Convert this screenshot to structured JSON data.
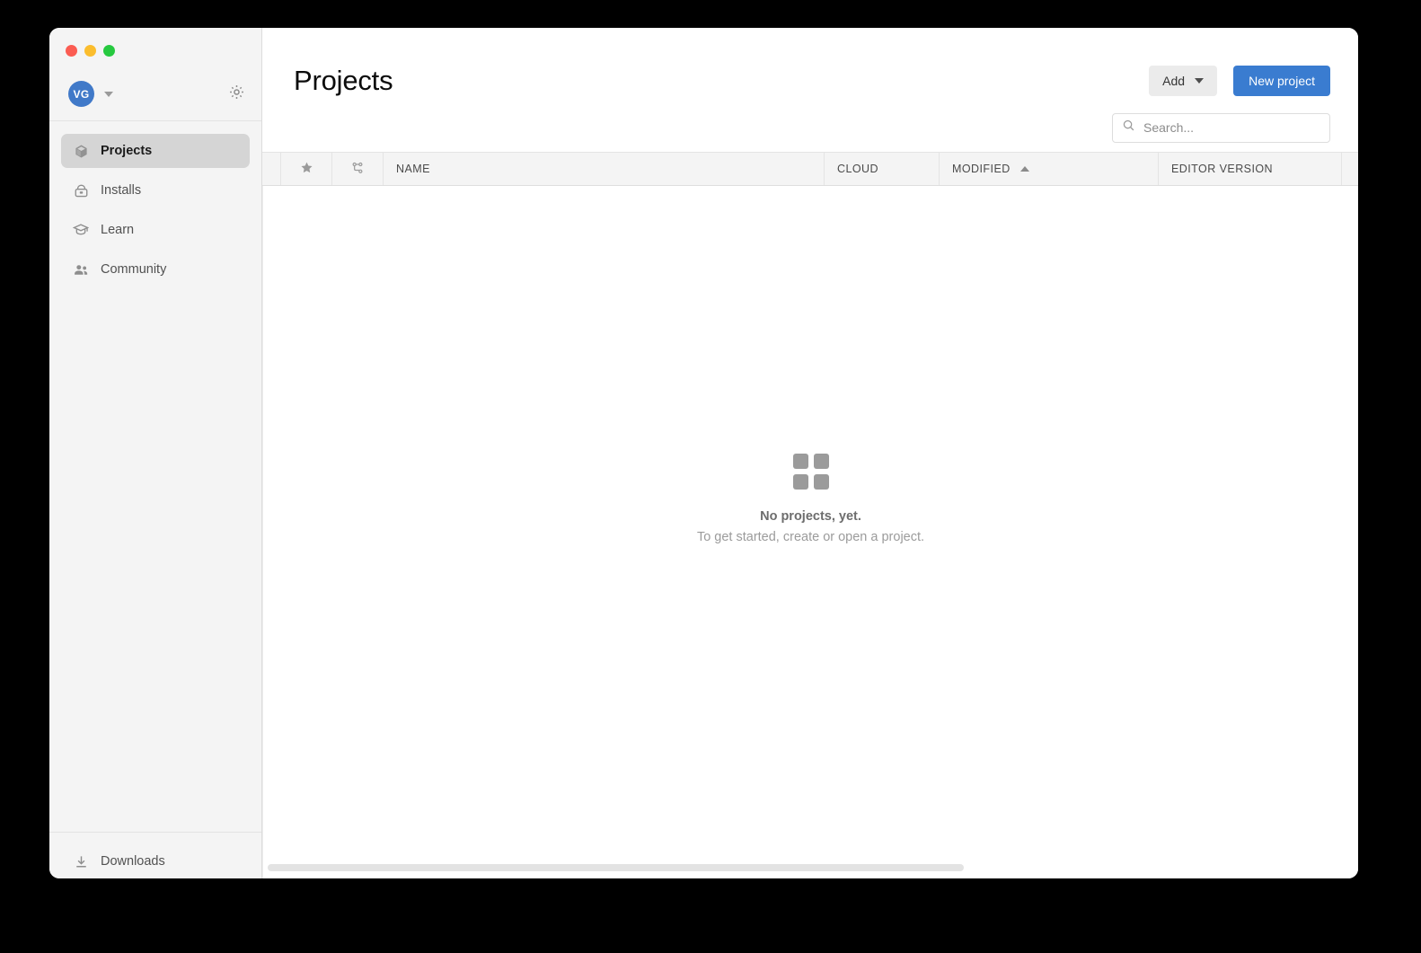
{
  "window": {
    "traffic_lights": [
      "close",
      "minimize",
      "maximize"
    ],
    "colors": {
      "accent": "#3a7cd0",
      "sidebar_bg": "#f4f4f4",
      "selected_item_bg": "#d5d5d5",
      "avatar_bg": "#4079c8"
    }
  },
  "sidebar": {
    "account": {
      "avatar_initials": "VG",
      "dropdown_icon": "chevron-down-icon",
      "settings_icon": "gear-icon"
    },
    "items": [
      {
        "label": "Projects",
        "icon": "cube-icon",
        "selected": true
      },
      {
        "label": "Installs",
        "icon": "install-icon",
        "selected": false
      },
      {
        "label": "Learn",
        "icon": "graduation-cap-icon",
        "selected": false
      },
      {
        "label": "Community",
        "icon": "people-icon",
        "selected": false
      }
    ],
    "downloads": {
      "label": "Downloads",
      "icon": "download-icon"
    }
  },
  "header": {
    "title": "Projects",
    "add_button": {
      "label": "Add",
      "caret_icon": "chevron-down-icon"
    },
    "new_project_button": {
      "label": "New project"
    }
  },
  "search": {
    "placeholder": "Search...",
    "value": "",
    "icon": "search-icon"
  },
  "table": {
    "columns": [
      {
        "key": "favorite",
        "label": "",
        "icon": "star-icon"
      },
      {
        "key": "version_control",
        "label": "",
        "icon": "branch-icon"
      },
      {
        "key": "name",
        "label": "NAME"
      },
      {
        "key": "cloud",
        "label": "CLOUD"
      },
      {
        "key": "modified",
        "label": "MODIFIED",
        "sort": "asc",
        "sort_icon": "chevron-up-icon"
      },
      {
        "key": "editor_version",
        "label": "EDITOR VERSION"
      }
    ],
    "rows": []
  },
  "empty_state": {
    "icon": "grid-2x2-icon",
    "title": "No projects, yet.",
    "subtitle": "To get started, create or open a project."
  },
  "scrollbar": {
    "orientation": "horizontal",
    "thumb_fraction": 0.63
  }
}
